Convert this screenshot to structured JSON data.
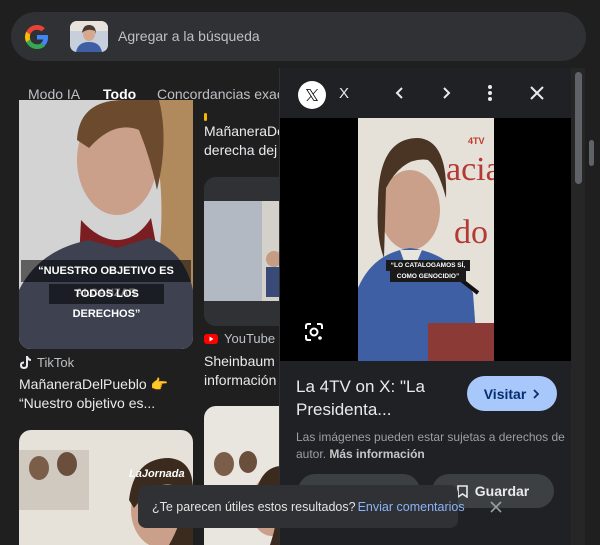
{
  "search": {
    "placeholder": "Agregar a la búsqueda"
  },
  "tabs": [
    {
      "label": "Modo IA"
    },
    {
      "label": "Todo"
    },
    {
      "label": "Concordancias exac"
    }
  ],
  "results": [
    {
      "caption_lines": [
        "“NUESTRO OBJETIVO ES ALCANZAR",
        "TODOS LOS DERECHOS”"
      ],
      "source": "TikTok",
      "title_lines": [
        "MañaneraDelPueblo 👉",
        "“Nuestro objetivo es..."
      ]
    },
    {
      "source": "",
      "title_lines": [
        "MañaneraDe",
        "derecha dej"
      ]
    },
    {
      "source": "YouTube",
      "title_lines": [
        "Sheinbaum p",
        "información"
      ]
    },
    {
      "watermark": "LaJornada"
    }
  ],
  "panel": {
    "site_name": "X",
    "badge": "4TV",
    "image_caption": [
      "“LO CATALOGAMOS SÍ,",
      "COMO GENOCIDIO”"
    ],
    "title_line1": "La 4TV on X: \"La",
    "title_line2": "Presidenta...",
    "visit_label": "Visitar",
    "note": "Las imágenes pueden estar sujetas a derechos de autor.",
    "more_info": "Más información",
    "save_label": "Guardar"
  },
  "toast": {
    "question": "¿Te parecen útiles estos resultados?",
    "link": "Enviar comentarios"
  },
  "colors": {
    "background": "#1f1f1f",
    "search_bg": "#303134",
    "accent_button": "#a8c7fa",
    "link": "#8ab4f8"
  }
}
